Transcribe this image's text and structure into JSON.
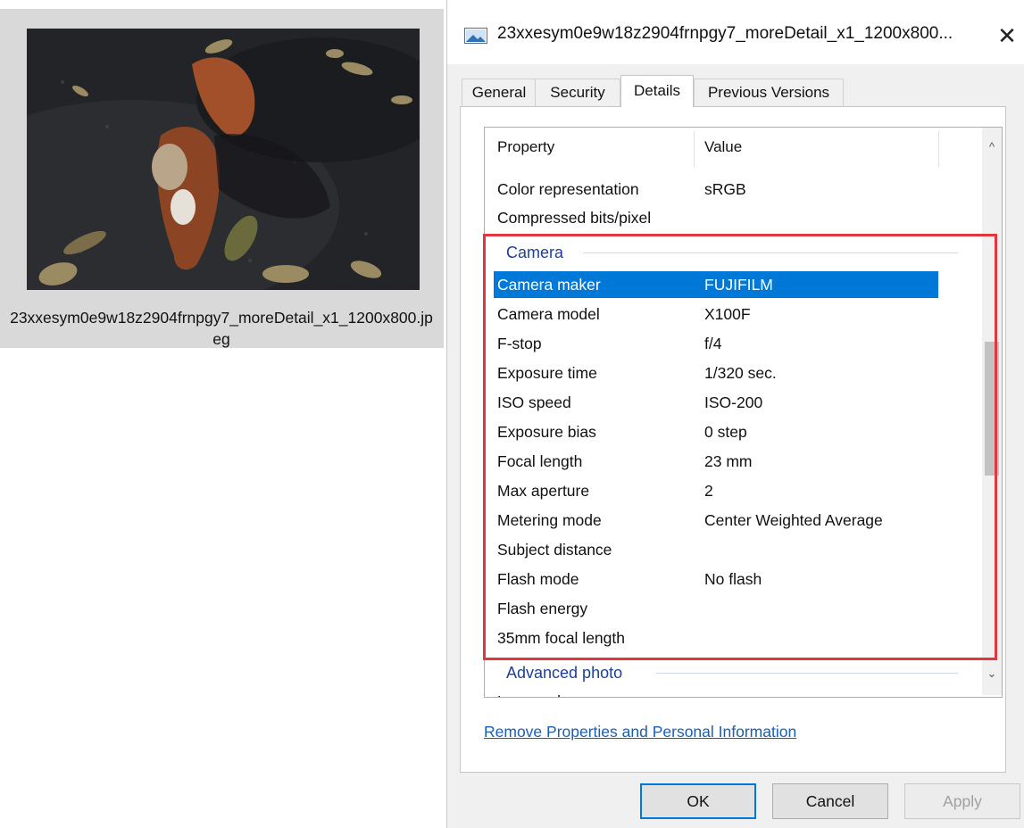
{
  "file": {
    "name": "23xxesym0e9w18z2904frnpgy7_moreDetail_x1_1200x800.jpeg",
    "thumbnail_icon": "squirrel-photo"
  },
  "dialog": {
    "title": "23xxesym0e9w18z2904frnpgy7_moreDetail_x1_1200x800...",
    "title_icon": "image-file-icon",
    "close_glyph": "✕",
    "tabs": [
      {
        "label": "General",
        "active": false
      },
      {
        "label": "Security",
        "active": false
      },
      {
        "label": "Details",
        "active": true
      },
      {
        "label": "Previous Versions",
        "active": false
      }
    ],
    "columns": {
      "property": "Property",
      "value": "Value"
    },
    "rows_top": [
      {
        "property": "Color representation",
        "value": "sRGB"
      },
      {
        "property": "Compressed bits/pixel",
        "value": ""
      }
    ],
    "group_camera": "Camera",
    "camera_rows": [
      {
        "property": "Camera maker",
        "value": "FUJIFILM",
        "selected": true
      },
      {
        "property": "Camera model",
        "value": "X100F"
      },
      {
        "property": "F-stop",
        "value": "f/4"
      },
      {
        "property": "Exposure time",
        "value": "1/320 sec."
      },
      {
        "property": "ISO speed",
        "value": "ISO-200"
      },
      {
        "property": "Exposure bias",
        "value": "0 step"
      },
      {
        "property": "Focal length",
        "value": "23 mm"
      },
      {
        "property": "Max aperture",
        "value": "2"
      },
      {
        "property": "Metering mode",
        "value": "Center Weighted Average"
      },
      {
        "property": "Subject distance",
        "value": ""
      },
      {
        "property": "Flash mode",
        "value": "No flash"
      },
      {
        "property": "Flash energy",
        "value": ""
      },
      {
        "property": "35mm focal length",
        "value": ""
      }
    ],
    "group_advanced": "Advanced photo",
    "partial_row": "Lens maker",
    "scroll_up": "^",
    "scroll_down": "⌄",
    "remove_link": "Remove Properties and Personal Information",
    "buttons": {
      "ok": "OK",
      "cancel": "Cancel",
      "apply": "Apply"
    },
    "highlight_color": "#e0383e",
    "selection_color": "#0078d7"
  }
}
